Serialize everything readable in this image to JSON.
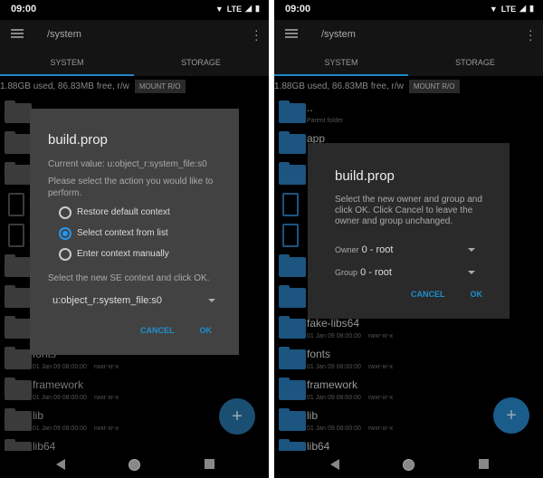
{
  "status": {
    "time": "09:00",
    "network": "LTE"
  },
  "appbar": {
    "path": "/system"
  },
  "tabs": [
    {
      "label": "SYSTEM"
    },
    {
      "label": "STORAGE"
    }
  ],
  "usage": {
    "text": "1.88GB used, 86.83MB free, r/w",
    "mount_label": "MOUNT R/O"
  },
  "left_rows": [
    {
      "type": "folder",
      "name": "",
      "meta": "",
      "perm": ""
    },
    {
      "type": "folder",
      "name": "",
      "meta": "",
      "perm": ""
    },
    {
      "type": "folder",
      "name": "",
      "meta": "",
      "perm": ""
    },
    {
      "type": "file",
      "name": "",
      "meta": "",
      "perm": ""
    },
    {
      "type": "file",
      "name": "",
      "meta": "",
      "perm": ""
    },
    {
      "type": "folder",
      "name": "",
      "meta": "",
      "perm": ""
    },
    {
      "type": "folder",
      "name": "",
      "meta": "",
      "perm": ""
    },
    {
      "type": "folder",
      "name": "",
      "meta": "",
      "perm": ""
    },
    {
      "type": "folder",
      "name": "fonts",
      "meta": "01 Jan 09 08:00:00",
      "perm": "rwxr-xr-x"
    },
    {
      "type": "folder",
      "name": "framework",
      "meta": "01 Jan 09 08:00:00",
      "perm": "rwxr-xr-x"
    },
    {
      "type": "folder",
      "name": "lib",
      "meta": "01 Jan 09 08:00:00",
      "perm": "rwxr-xr-x"
    },
    {
      "type": "folder",
      "name": "lib64",
      "meta": "",
      "perm": ""
    }
  ],
  "right_rows": [
    {
      "type": "folder",
      "name": "..",
      "meta": "Parent folder",
      "perm": ""
    },
    {
      "type": "folder",
      "name": "app",
      "meta": "",
      "perm": ""
    },
    {
      "type": "folder",
      "name": "",
      "meta": "",
      "perm": ""
    },
    {
      "type": "file",
      "name": "",
      "meta": "",
      "perm": ""
    },
    {
      "type": "file",
      "name": "",
      "meta": "",
      "perm": ""
    },
    {
      "type": "folder",
      "name": "",
      "meta": "",
      "perm": ""
    },
    {
      "type": "folder",
      "name": "",
      "meta": "",
      "perm": ""
    },
    {
      "type": "folder",
      "name": "fake-libs64",
      "meta": "01 Jan 09 08:00:00",
      "perm": "rwxr-xr-x"
    },
    {
      "type": "folder",
      "name": "fonts",
      "meta": "01 Jan 09 08:00:00",
      "perm": "rwxr-xr-x"
    },
    {
      "type": "folder",
      "name": "framework",
      "meta": "01 Jan 09 08:00:00",
      "perm": "rwxr-xr-x"
    },
    {
      "type": "folder",
      "name": "lib",
      "meta": "01 Jan 09 08:00:00",
      "perm": "rwxr-xr-x"
    },
    {
      "type": "folder",
      "name": "lib64",
      "meta": "",
      "perm": ""
    }
  ],
  "fab_label": "+",
  "se_dialog": {
    "title": "build.prop",
    "current": "Current value: u:object_r:system_file:s0",
    "prompt": "Please select the action you would like to perform.",
    "options": [
      {
        "label": "Restore default context",
        "selected": false
      },
      {
        "label": "Select context from list",
        "selected": true
      },
      {
        "label": "Enter context manually",
        "selected": false
      }
    ],
    "instruction": "Select the new SE context and click OK.",
    "selected_context": "u:object_r:system_file:s0",
    "cancel": "CANCEL",
    "ok": "OK"
  },
  "owner_dialog": {
    "title": "build.prop",
    "text": "Select the new owner and group and click OK. Click Cancel to leave the owner and group unchanged.",
    "owner_label": "Owner",
    "owner_value": "0 - root",
    "group_label": "Group",
    "group_value": "0 - root",
    "cancel": "CANCEL",
    "ok": "OK"
  },
  "colors": {
    "accent": "#1e88c8",
    "folder": "#1b5580",
    "fab": "#1b5580"
  }
}
